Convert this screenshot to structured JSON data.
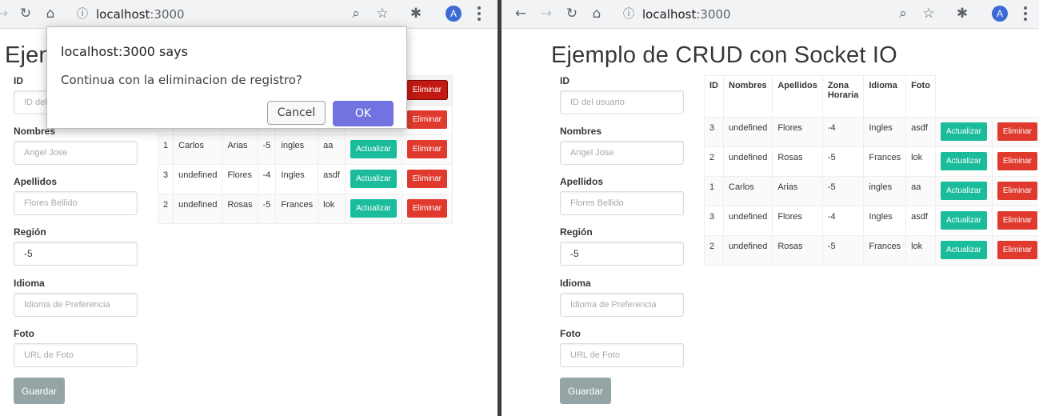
{
  "browser": {
    "url_host": "localhost",
    "url_port": ":3000",
    "avatar_letter": "A"
  },
  "dialog": {
    "title": "localhost:3000 says",
    "message": "Continua con la eliminacion de registro?",
    "cancel_label": "Cancel",
    "ok_label": "OK"
  },
  "page": {
    "title": "Ejemplo de CRUD con Socket IO",
    "title_left_visible": "Ejem"
  },
  "form": {
    "id_label": "ID",
    "id_placeholder": "ID del usuario",
    "id_placeholder_left": "ID del",
    "nombres_label": "Nombres",
    "nombres_label_left": "Nombres",
    "nombres_placeholder": "Angel Jose",
    "apellidos_label": "Apellidos",
    "apellidos_placeholder": "Flores Bellido",
    "region_label": "Región",
    "region_value": "-5",
    "idioma_label": "Idioma",
    "idioma_placeholder": "Idioma de Preferencia",
    "foto_label": "Foto",
    "foto_placeholder": "URL de Foto",
    "save_label": "Guardar"
  },
  "table": {
    "headers": [
      "ID",
      "Nombres",
      "Apellidos",
      "Zona Horaria",
      "Idioma",
      "Foto"
    ],
    "update_label": "Actualizar",
    "delete_label": "Eliminar",
    "rows": [
      [
        "3",
        "undefined",
        "Flores",
        "-4",
        "Ingles",
        "asdf"
      ],
      [
        "2",
        "undefined",
        "Rosas",
        "-5",
        "Frances",
        "lok"
      ],
      [
        "1",
        "Carlos",
        "Arias",
        "-5",
        "ingles",
        "aa"
      ],
      [
        "3",
        "undefined",
        "Flores",
        "-4",
        "Ingles",
        "asdf"
      ],
      [
        "2",
        "undefined",
        "Rosas",
        "-5",
        "Frances",
        "lok"
      ]
    ]
  },
  "colors": {
    "update_button": "#1abc9c",
    "delete_button": "#e03a2f",
    "ok_button": "#7272e0",
    "save_button": "#95a5a6"
  }
}
